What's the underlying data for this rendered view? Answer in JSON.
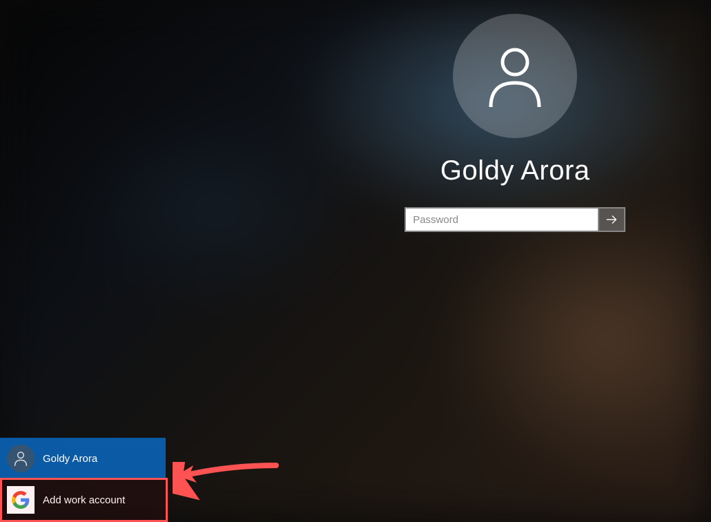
{
  "login": {
    "username": "Goldy Arora",
    "password_placeholder": "Password"
  },
  "accounts": [
    {
      "label": "Goldy Arora",
      "icon": "user-icon",
      "selected": true
    },
    {
      "label": "Add work account",
      "icon": "google-icon",
      "selected": false
    }
  ],
  "colors": {
    "highlight": "#ff5252",
    "selected_bg": "#0a5aa5"
  }
}
